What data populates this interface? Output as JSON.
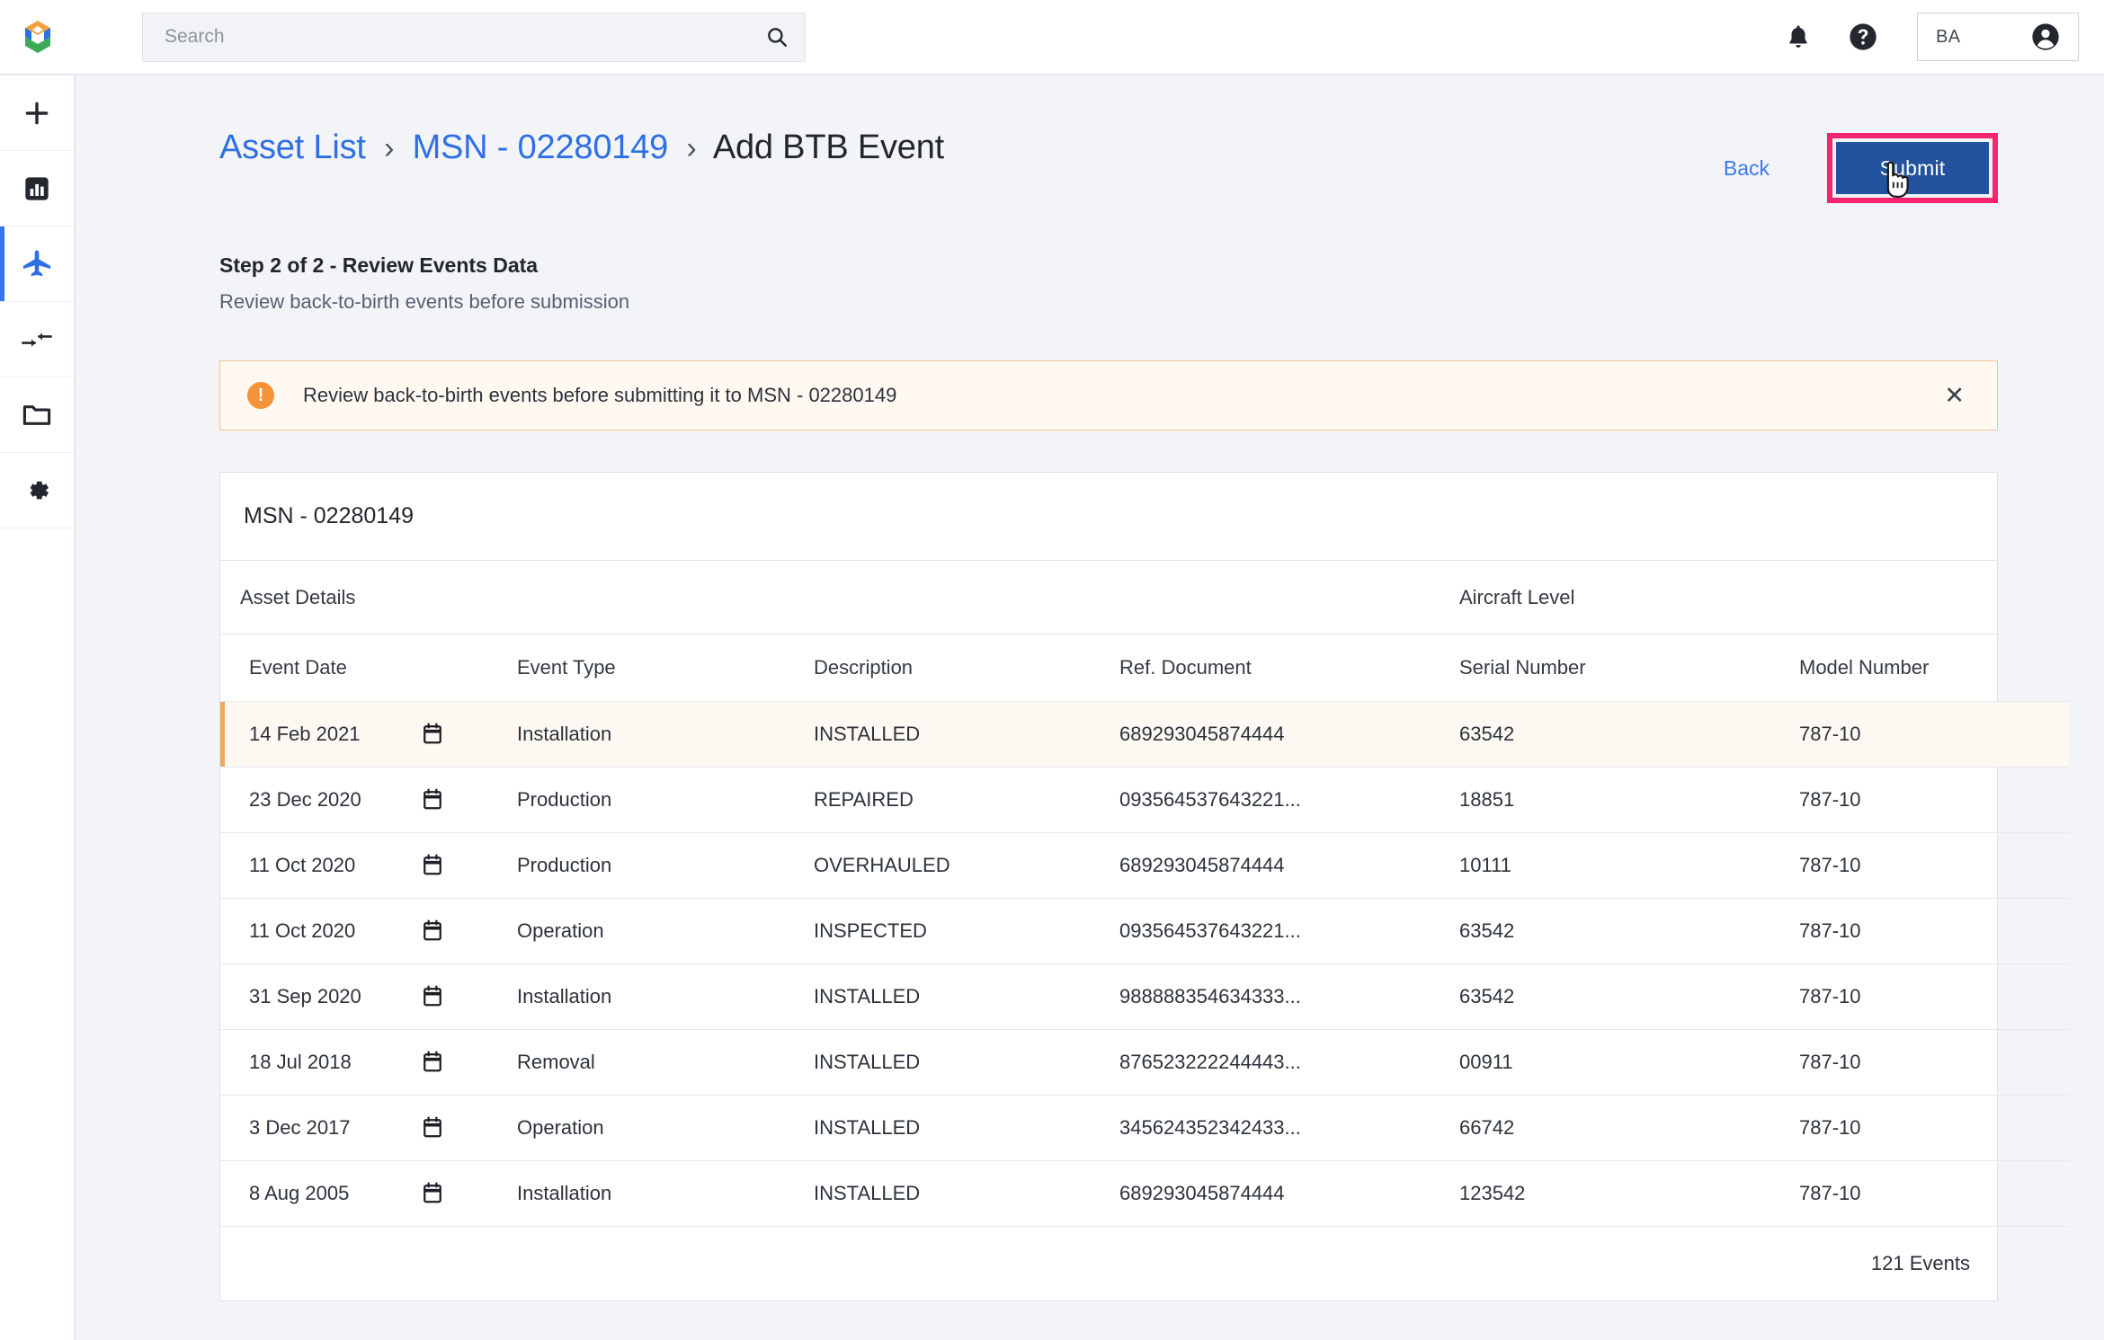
{
  "brand": {
    "logo_icon": "hexagon-logo"
  },
  "search": {
    "placeholder": "Search",
    "value": "",
    "icon": "search-icon"
  },
  "topbar": {
    "notifications_icon": "bell-icon",
    "help_icon": "question-circle-icon",
    "user_initials": "BA",
    "user_icon": "account-circle-icon"
  },
  "sidebar": {
    "items": [
      {
        "name": "add",
        "icon": "plus-icon",
        "active": false
      },
      {
        "name": "dashboard",
        "icon": "bar-chart-icon",
        "active": false
      },
      {
        "name": "aircraft",
        "icon": "airplane-icon",
        "active": true
      },
      {
        "name": "transfer",
        "icon": "arrows-compress-icon",
        "active": false
      },
      {
        "name": "documents",
        "icon": "folder-icon",
        "active": false
      },
      {
        "name": "settings",
        "icon": "gear-icon",
        "active": false
      }
    ]
  },
  "breadcrumb": {
    "items": [
      {
        "label": "Asset List",
        "link": true
      },
      {
        "label": "MSN - 02280149",
        "link": true
      },
      {
        "label": "Add BTB Event",
        "link": false
      }
    ],
    "separator": "›"
  },
  "actions": {
    "back_label": "Back",
    "submit_label": "Submit",
    "submit_bg": "#23539e",
    "highlight_color": "#f4256e"
  },
  "step": {
    "title": "Step 2 of 2 - Review Events Data",
    "subtitle": "Review back-to-birth events before submission"
  },
  "alert": {
    "icon": "exclamation-icon",
    "icon_color": "#f59338",
    "message": "Review back-to-birth events before submitting it to MSN - 02280149",
    "close_label": "✕"
  },
  "card": {
    "title": "MSN - 02280149",
    "group_headers": {
      "asset": "Asset Details",
      "aircraft": "Aircraft Level"
    },
    "columns": [
      "Event Date",
      "Event Type",
      "Description",
      "Ref. Document",
      "Serial Number",
      "Model Number"
    ],
    "rows": [
      {
        "date": "14 Feb 2021",
        "type": "Installation",
        "description": "INSTALLED",
        "ref": "689293045874444",
        "serial": "63542",
        "model": "787-10",
        "highlight": true
      },
      {
        "date": "23 Dec 2020",
        "type": "Production",
        "description": "REPAIRED",
        "ref": "093564537643221...",
        "serial": "18851",
        "model": "787-10",
        "highlight": false
      },
      {
        "date": "11 Oct 2020",
        "type": "Production",
        "description": "OVERHAULED",
        "ref": "689293045874444",
        "serial": "10111",
        "model": "787-10",
        "highlight": false
      },
      {
        "date": "11 Oct 2020",
        "type": "Operation",
        "description": "INSPECTED",
        "ref": "093564537643221...",
        "serial": "63542",
        "model": "787-10",
        "highlight": false
      },
      {
        "date": "31 Sep 2020",
        "type": "Installation",
        "description": "INSTALLED",
        "ref": "988888354634333...",
        "serial": "63542",
        "model": "787-10",
        "highlight": false
      },
      {
        "date": "18 Jul 2018",
        "type": "Removal",
        "description": "INSTALLED",
        "ref": "876523222244443...",
        "serial": "00911",
        "model": "787-10",
        "highlight": false
      },
      {
        "date": "3 Dec 2017",
        "type": "Operation",
        "description": "INSTALLED",
        "ref": "345624352342433...",
        "serial": "66742",
        "model": "787-10",
        "highlight": false
      },
      {
        "date": "8 Aug 2005",
        "type": "Installation",
        "description": "INSTALLED",
        "ref": "689293045874444",
        "serial": "123542",
        "model": "787-10",
        "highlight": false
      }
    ],
    "row_icon": "calendar-icon",
    "footer_count": "121 Events"
  }
}
